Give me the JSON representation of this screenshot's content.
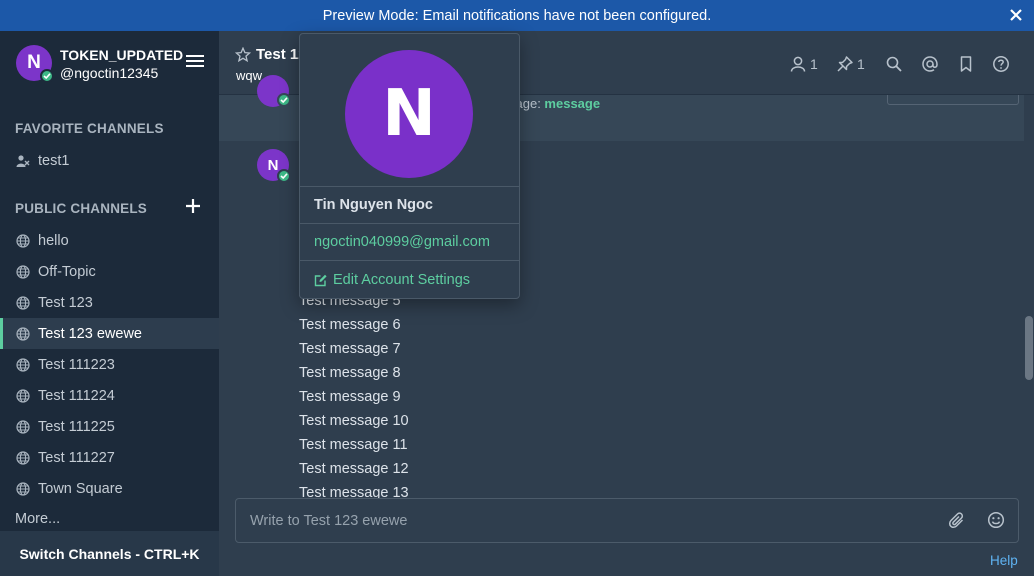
{
  "banner": {
    "text": "Preview Mode: Email notifications have not been configured.",
    "close_icon": "close-icon"
  },
  "sidebar": {
    "team_name": "TOKEN_UPDATED",
    "username": "@ngoctin12345",
    "avatar_initial": "N",
    "favorites_title": "FAVORITE CHANNELS",
    "favorites": [
      {
        "label": "test1",
        "icon": "dm-user-icon"
      }
    ],
    "public_title": "PUBLIC CHANNELS",
    "channels": [
      {
        "label": "hello",
        "active": false
      },
      {
        "label": "Off-Topic",
        "active": false
      },
      {
        "label": "Test 123",
        "active": false
      },
      {
        "label": "Test 123 ewewe",
        "active": true
      },
      {
        "label": "Test 111223",
        "active": false
      },
      {
        "label": "Test 111224",
        "active": false
      },
      {
        "label": "Test 111225",
        "active": false
      },
      {
        "label": "Test 111227",
        "active": false
      },
      {
        "label": "Town Square",
        "active": false
      }
    ],
    "more": "More...",
    "switch_channels": "Switch Channels - CTRL+K"
  },
  "header": {
    "title": "Test 12",
    "purpose": "wqw",
    "members_count": "1",
    "pinned_count": "1"
  },
  "pinned_preview": {
    "prefix": "sage: ",
    "highlight": "message"
  },
  "posts": {
    "avatar_initial": "N",
    "messages": [
      "Test message 5",
      "Test message 6",
      "Test message 7",
      "Test message 8",
      "Test message 9",
      "Test message 10",
      "Test message 11",
      "Test message 12",
      "Test message 13"
    ]
  },
  "input": {
    "placeholder": "Write to Test 123 ewewe"
  },
  "help": "Help",
  "popover": {
    "avatar_initial": "N",
    "full_name": "Tin Nguyen Ngoc",
    "email": "ngoctin040999@gmail.com",
    "edit_label": "Edit Account Settings"
  },
  "colors": {
    "accent": "#5dcea0",
    "avatar": "#7c35c9",
    "banner": "#1c58a8",
    "sidebar": "#1c2a3a",
    "link": "#5fb3f2"
  }
}
